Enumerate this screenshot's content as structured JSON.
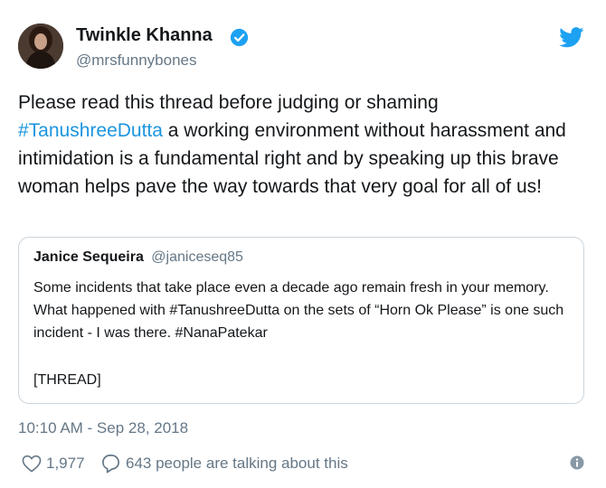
{
  "author": {
    "name": "Twinkle Khanna",
    "handle": "@mrsfunnybones",
    "verified": true,
    "avatar": "profile-photo"
  },
  "tweet": {
    "text_before": "Please read this thread before judging or shaming",
    "hashtag": "#TanushreeDutta",
    "text_after": " a working environment without harassment and intimidation is a fundamental right and by speaking up this brave woman helps pave the way towards that very goal for all of us!"
  },
  "quote": {
    "name": "Janice Sequeira",
    "handle": "@janiceseq85",
    "text": "Some incidents that take place even a decade ago remain fresh in your memory. What happened with #TanushreeDutta on the sets of “Horn Ok Please” is one such incident - I was there. #NanaPatekar",
    "thread_marker": "[THREAD]"
  },
  "timestamp": "10:10 AM - Sep 28, 2018",
  "actions": {
    "likes": "1,977",
    "talking": "643 people are talking about this"
  },
  "icons": {
    "verified": "verified-badge-icon",
    "brand": "twitter-bird-icon",
    "like": "heart-icon",
    "reply": "reply-bubble-icon",
    "info": "info-icon"
  },
  "colors": {
    "link": "#1b95e0",
    "secondary_text": "#657786",
    "primary_text": "#14171a",
    "border": "#ccd6dd"
  }
}
